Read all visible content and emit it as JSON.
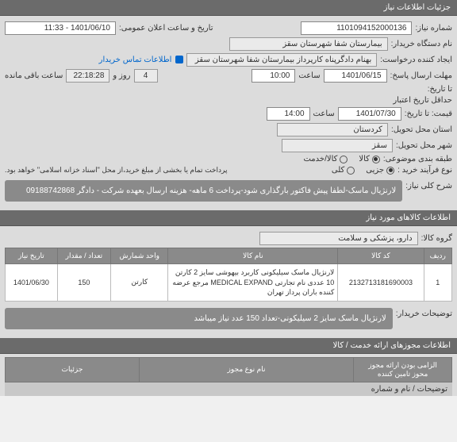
{
  "sections": {
    "info_header": "جزئیات اطلاعات نیاز",
    "items_header": "اطلاعات کالاهای مورد نیاز",
    "permits_header": "اطلاعات مجوزهای ارائه خدمت / کالا"
  },
  "labels": {
    "need_number": "شماره نیاز:",
    "device_name": "نام دستگاه خریدار:",
    "requester": "ایجاد کننده درخواست:",
    "response_deadline": "مهلت ارسال پاسخ:",
    "until_date": "تا تاریخ:",
    "min_validity": "حداقل تاریخ اعتبار",
    "price_until": "قیمت: تا تاریخ:",
    "province": "استان محل تحویل:",
    "city": "شهر محل تحویل:",
    "classification": "طبقه بندی موضوعی:",
    "purchase_type": "نوع فرآیند خرید :",
    "general_desc": "شرح کلی نیاز:",
    "goods_group": "گروه کالا:",
    "buyer_notes": "توضیحات خریدار:",
    "public_datetime": "تاریخ و ساعت اعلان عمومی:",
    "contact_link": "اطلاعات تماس خریدار",
    "hour": "ساعت",
    "day_and": "روز و",
    "remaining": "ساعت باقی مانده",
    "mandatory": "الزامی بودن ارائه مجوز",
    "mandatory_sub": "محوز تامین کننده"
  },
  "values": {
    "need_number": "1101094152000136",
    "device_name": "بیمارستان شفا شهرستان سقز",
    "requester": "بهنام دادگرپناه کارپرداز بیمارستان شفا شهرستان سقز",
    "public_datetime": "1401/06/10 - 11:33",
    "response_date": "1401/06/15",
    "response_time": "10:00",
    "remaining_days": "4",
    "remaining_time": "22:18:28",
    "validity_date": "1401/07/30",
    "validity_time": "14:00",
    "province": "کردستان",
    "city": "سقز",
    "general_desc": "لارنژیال ماسک-لطفا پیش فاکتور بارگذاری شود-پرداخت 6 ماهه- هزینه ارسال بعهده شرکت - دادگر 09188742868",
    "goods_group": "دارو، پزشکی و سلامت",
    "buyer_notes": "لارنژیال ماسک سایز 2 سیلیکونی-تعداد 150 عدد نیاز میباشد"
  },
  "classification": {
    "options": [
      {
        "label": "کالا",
        "checked": true
      },
      {
        "label": "کالا/خدمت",
        "checked": false
      }
    ]
  },
  "purchase_type": {
    "options": [
      {
        "label": "جزیی",
        "checked": true
      },
      {
        "label": "کلی",
        "checked": false
      }
    ],
    "note": "پرداخت تمام یا بخشی از مبلغ خرید،از محل \"اسناد خزانه اسلامی\" خواهد بود."
  },
  "tbl": {
    "headers": {
      "row": "ردیف",
      "code": "کد کالا",
      "name": "نام کالا",
      "unit": "واحد شمارش",
      "qty": "تعداد / مقدار",
      "date": "تاریخ نیاز"
    },
    "rows": [
      {
        "row": "1",
        "code": "2132713181690003",
        "name": "لارنژیال ماسک سیلیکونی کاربرد بیهوشی سایز 2 کارتن 10 عددی نام تجارتی MEDICAL EXPAND مرجع عرضه کننده باران پرداز تهران",
        "unit": "کارتن",
        "qty": "150",
        "date": "1401/06/30"
      }
    ]
  },
  "permits": {
    "sub_header": "نام نوع مجوز"
  },
  "footer": {
    "right_link": "جزئیات",
    "left_text": "توضیحات / نام و شماره"
  }
}
